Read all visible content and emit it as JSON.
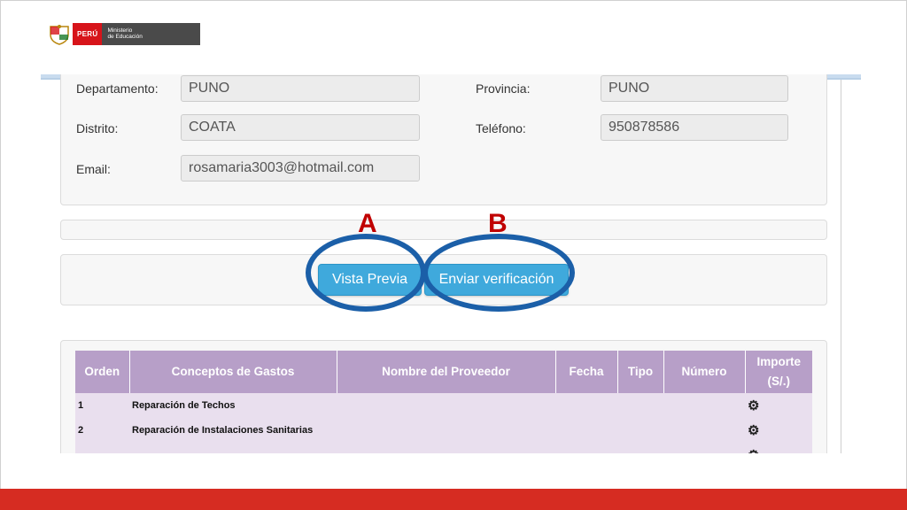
{
  "logo": {
    "peru": "PERÚ",
    "ministry_line1": "Ministerio",
    "ministry_line2": "de Educación"
  },
  "form": {
    "departamento_label": "Departamento:",
    "departamento_value": "PUNO",
    "provincia_label": "Provincia:",
    "provincia_value": "PUNO",
    "distrito_label": "Distrito:",
    "distrito_value": "COATA",
    "telefono_label": "Teléfono:",
    "telefono_value": "950878586",
    "email_label": "Email:",
    "email_value": "rosamaria3003@hotmail.com"
  },
  "actions": {
    "preview_label": "Vista Previa",
    "send_label": "Enviar verificación",
    "marker_a": "A",
    "marker_b": "B"
  },
  "colors": {
    "button": "#3fa9dc",
    "ring": "#1b5fa8",
    "marker": "#c00000",
    "table_header": "#b79fc8",
    "table_row": "#e9dfee",
    "bottom_bar": "#d62c22"
  },
  "table": {
    "headers": [
      "Orden",
      "Conceptos de Gastos",
      "Nombre del Proveedor",
      "Fecha",
      "Tipo",
      "Número",
      "Importe (S/.)"
    ],
    "rows": [
      {
        "orden": "1",
        "concepto": "Reparación de Techos",
        "icon": "gears-icon"
      },
      {
        "orden": "2",
        "concepto": "Reparación de Instalaciones Sanitarias",
        "icon": "gears-icon"
      },
      {
        "orden": "",
        "concepto": "",
        "icon": "gears-icon"
      }
    ]
  }
}
